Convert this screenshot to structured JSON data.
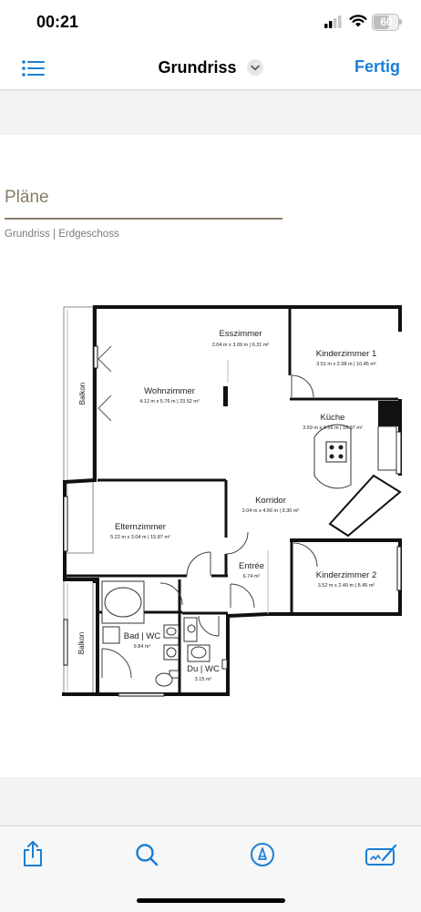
{
  "status_bar": {
    "time": "00:21",
    "battery": "60"
  },
  "nav": {
    "title": "Grundriss",
    "done_label": "Fertig"
  },
  "document": {
    "heading": "Pläne",
    "subheading": "Grundriss | Erdgeschoss",
    "rooms": {
      "esszimmer": {
        "name": "Esszimmer",
        "dims": "2.04 m x 3.09 m | 6.31 m²"
      },
      "kinderzimmer1": {
        "name": "Kinderzimmer 1",
        "dims": "3.51 m x 2.98 m | 10.45 m²"
      },
      "wohnzimmer": {
        "name": "Wohnzimmer",
        "dims": "4.12 m x 5.76 m | 23.52 m²"
      },
      "kueche": {
        "name": "Küche",
        "dims": "3.59 m x 4.56 m | 16.37 m²"
      },
      "korridor": {
        "name": "Korridor",
        "dims": "2.04 m x 4.56 m | 9.30 m²"
      },
      "elternzimmer": {
        "name": "Elternzimmer",
        "dims": "5.22 m x 3.04 m | 15.87 m²"
      },
      "entree": {
        "name": "Entrée",
        "dims": "6.74 m²"
      },
      "kinderzimmer2": {
        "name": "Kinderzimmer 2",
        "dims": "3.52 m x 2.40 m | 8.45 m²"
      },
      "bad": {
        "name": "Bad | WC",
        "dims": "9.84 m²"
      },
      "du": {
        "name": "Du | WC",
        "dims": "3.15 m²"
      },
      "balkon_top": {
        "name": "Balkon"
      },
      "balkon_bottom": {
        "name": "Balkon"
      }
    }
  },
  "toolbar": {
    "icons": [
      "share-icon",
      "search-icon",
      "markup-icon",
      "signature-icon"
    ]
  },
  "colors": {
    "accent": "#1a7fd6",
    "heading": "#8a7c68"
  }
}
